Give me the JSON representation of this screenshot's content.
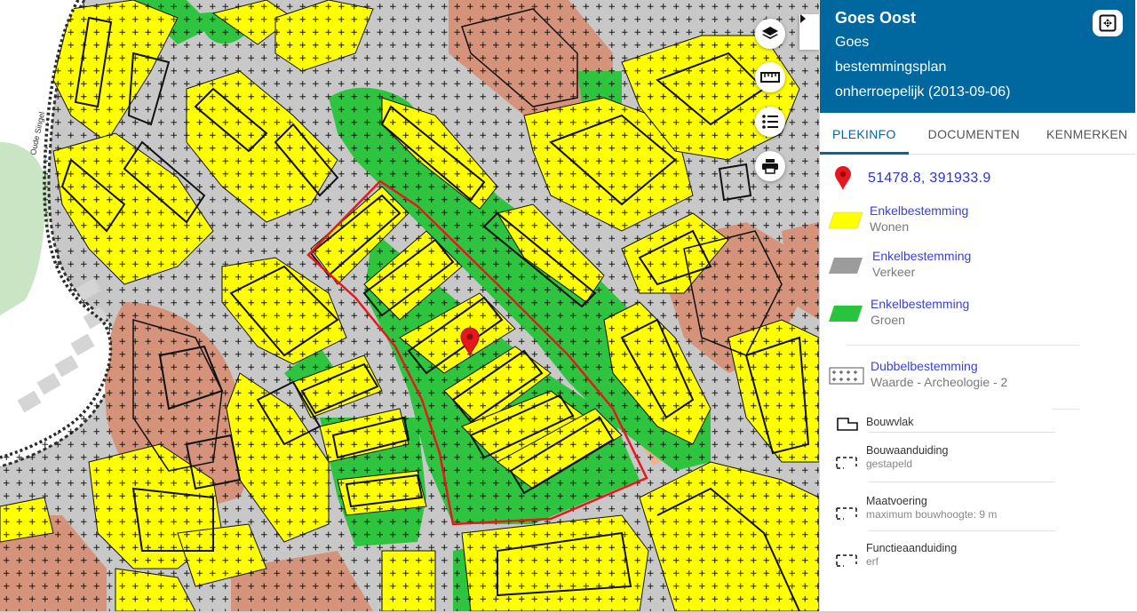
{
  "panel": {
    "title": "Goes Oost",
    "subtitle_lines": [
      "Goes",
      "bestemmingsplan",
      "onherroepelijk (2013-09-06)"
    ],
    "tabs": [
      {
        "label": "PLEKINFO",
        "active": true
      },
      {
        "label": "DOCUMENTEN",
        "active": false
      },
      {
        "label": "KENMERKEN",
        "active": false
      }
    ],
    "coordinates": "51478.8, 391933.9",
    "legend": [
      {
        "category": "Enkelbestemming",
        "value": "Wonen",
        "symbol": "yellow-parallelogram",
        "color": "#ffff00"
      },
      {
        "category": "Enkelbestemming",
        "value": "Verkeer",
        "symbol": "grey-parallelogram",
        "color": "#9c9c9c"
      },
      {
        "category": "Enkelbestemming",
        "value": "Groen",
        "symbol": "green-parallelogram",
        "color": "#29c43e"
      },
      {
        "category": "Dubbelbestemming",
        "value": "Waarde - Archeologie - 2",
        "symbol": "plus-grid"
      },
      {
        "title": "Bouwvlak",
        "symbol": "bouwvlak-outline"
      },
      {
        "title": "Bouwaanduiding",
        "value": "gestapeld",
        "symbol": "dashed-bracket"
      },
      {
        "title": "Maatvoering",
        "value": "maximum bouwhoogte: 9 m",
        "symbol": "dashed-bracket"
      },
      {
        "title": "Functieaanduiding",
        "value": "erf",
        "symbol": "dashed-bracket"
      }
    ]
  },
  "map_controls": [
    "layers-icon",
    "measure-ruler-icon",
    "legend-list-icon",
    "print-icon"
  ],
  "map": {
    "street_label": "Oude Singel",
    "colors": {
      "wonen": "#ffff00",
      "verkeer": "#c8c8c8",
      "groen": "#2ec43f",
      "gemengd": "#d4937a",
      "bedrijf": "#f0b090",
      "water": "#ffffff",
      "selection": "#e8171e",
      "pin": "#e8171e"
    }
  },
  "colors": {
    "header_bg": "#00689e",
    "link": "#3a41d4",
    "coord": "#2a35c8"
  }
}
